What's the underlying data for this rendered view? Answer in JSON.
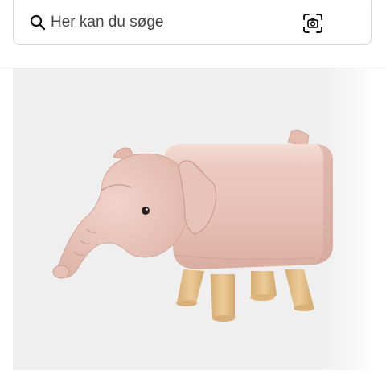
{
  "search": {
    "placeholder": "Her kan du søge",
    "value": ""
  },
  "icons": {
    "search": "search-icon",
    "visual_search": "camera-scan-icon"
  },
  "product": {
    "image": "pink-elephant-stool",
    "colors": {
      "leather": "#e9c4b9",
      "legs": "#e3c08d",
      "background": "#efefef"
    }
  }
}
